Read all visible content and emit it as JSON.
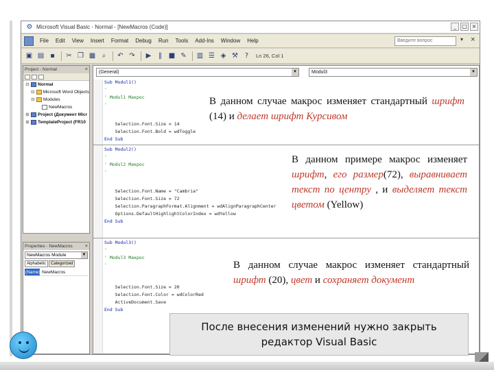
{
  "window": {
    "title": "Microsoft Visual Basic - Normal - [NewMacros (Code)]",
    "buttons": [
      "_",
      "□",
      "×"
    ]
  },
  "menu": {
    "items": [
      "File",
      "Edit",
      "View",
      "Insert",
      "Format",
      "Debug",
      "Run",
      "Tools",
      "Add-Ins",
      "Window",
      "Help"
    ],
    "help_placeholder": "Введите вопрос",
    "help_arrow": "▾",
    "close": "×"
  },
  "toolbar": {
    "position": "Ln 26, Col 1"
  },
  "project_panel": {
    "title": "Project - Normal",
    "items": [
      {
        "glyph": "⊟",
        "label": "Normal",
        "bold": true,
        "indent": 0,
        "icon": "vb"
      },
      {
        "glyph": "⊟",
        "label": "Microsoft Word Objects",
        "bold": false,
        "indent": 1,
        "icon": "folder"
      },
      {
        "glyph": "⊟",
        "label": "Modules",
        "bold": false,
        "indent": 1,
        "icon": "folder"
      },
      {
        "glyph": "",
        "label": "NewMacros",
        "bold": false,
        "indent": 2,
        "icon": "mod"
      },
      {
        "glyph": "⊞",
        "label": "Project (Документ Micr",
        "bold": true,
        "indent": 0,
        "icon": "vb"
      },
      {
        "glyph": "⊞",
        "label": "TemplateProject (FR10",
        "bold": true,
        "indent": 0,
        "icon": "vb"
      }
    ]
  },
  "props_panel": {
    "title": "Properties - NewMacros",
    "select": "NewMacros Module",
    "tabs": [
      "Alphabetic",
      "Categorized"
    ],
    "row_key": "(Name)",
    "row_value": "NewMacros"
  },
  "code": {
    "combo_left": "(General)",
    "combo_right": "Modul3",
    "lines": [
      {
        "text": "Sub Modul1()",
        "cls": "kw"
      },
      {
        "text": "'",
        "cls": "cm"
      },
      {
        "text": "' Modul1 Макрос",
        "cls": "cm"
      },
      {
        "text": "'",
        "cls": "cm"
      },
      {
        "text": "",
        "cls": "tx"
      },
      {
        "text": "    Selection.Font.Size = 14",
        "cls": "tx"
      },
      {
        "text": "    Selection.Font.Bold = wdToggle",
        "cls": "tx"
      },
      {
        "text": "End Sub",
        "cls": "kw"
      },
      {
        "text": "Sub Modul2()",
        "cls": "kw"
      },
      {
        "text": "'",
        "cls": "cm"
      },
      {
        "text": "' Modul2 Макрос",
        "cls": "cm"
      },
      {
        "text": "'",
        "cls": "cm"
      },
      {
        "text": "",
        "cls": "tx"
      },
      {
        "text": "    Selection.Font.Name = \"Cambria\"",
        "cls": "tx"
      },
      {
        "text": "    Selection.Font.Size = 72",
        "cls": "tx"
      },
      {
        "text": "    Selection.ParagraphFormat.Alignment = wdAlignParagraphCenter",
        "cls": "tx"
      },
      {
        "text": "    Options.DefaultHighlightColorIndex = wdYellow",
        "cls": "tx"
      },
      {
        "text": "End Sub",
        "cls": "kw"
      },
      {
        "text": "Sub Modul3()",
        "cls": "kw"
      },
      {
        "text": "'",
        "cls": "cm"
      },
      {
        "text": "' Modul3 Макрос",
        "cls": "cm"
      },
      {
        "text": "'",
        "cls": "cm"
      },
      {
        "text": "",
        "cls": "tx"
      },
      {
        "text": "    Selection.Font.Size = 20",
        "cls": "tx"
      },
      {
        "text": "    Selection.Font.Color = wdColorRed",
        "cls": "tx"
      },
      {
        "text": "    ActiveDocument.Save",
        "cls": "tx"
      },
      {
        "text": "End Sub",
        "cls": "kw"
      }
    ]
  },
  "annotations": {
    "a1": [
      {
        "t": "В данном случае макрос изменяет стандартный ",
        "i": false
      },
      {
        "t": "шрифт",
        "i": true
      },
      {
        "t": " (14) и ",
        "i": false
      },
      {
        "t": "делает шрифт Курсивом",
        "i": true
      }
    ],
    "a2": [
      {
        "t": "В данном примере макрос изменяет ",
        "i": false
      },
      {
        "t": "шрифт",
        "i": true
      },
      {
        "t": ", ",
        "i": false
      },
      {
        "t": "его размер",
        "i": true
      },
      {
        "t": "(72), ",
        "i": false
      },
      {
        "t": "выравнивает текст по центру",
        "i": true
      },
      {
        "t": " , и ",
        "i": false
      },
      {
        "t": "выделяет текст цветом",
        "i": true
      },
      {
        "t": " (Yellow)",
        "i": false
      }
    ],
    "a3": [
      {
        "t": "В данном случае макрос изменяет стандартный ",
        "i": false
      },
      {
        "t": "шрифт",
        "i": true
      },
      {
        "t": " (20), ",
        "i": false
      },
      {
        "t": "цвет",
        "i": true
      },
      {
        "t": " и ",
        "i": false
      },
      {
        "t": "сохраняет документ",
        "i": true
      }
    ]
  },
  "note": {
    "line1": "После внесения изменений нужно закрыть",
    "line2": "редактор Visual Basic"
  }
}
